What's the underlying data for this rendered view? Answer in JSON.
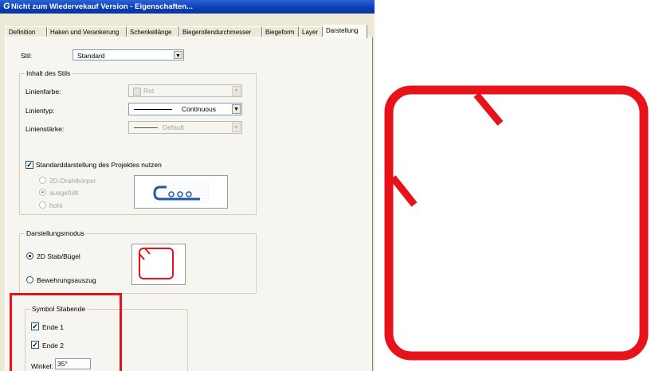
{
  "window": {
    "title": "Nicht zum Wiedervekauf Version - Eigenschaften...",
    "app_icon": "G"
  },
  "tabs": [
    "Definition",
    "Haken und Verankerung",
    "Schenkellänge",
    "Biegerollendurchmesser",
    "Biegeform",
    "Layer",
    "Darstellung"
  ],
  "active_tab": "Darstellung",
  "stil": {
    "label": "Stil:",
    "value": "Standard"
  },
  "inhalt": {
    "group_label": "Inhalt des Stils",
    "linienfarbe": {
      "label": "Linienfarbe:",
      "value": "Rot"
    },
    "linientyp": {
      "label": "Linientyp:",
      "value": "Continuous"
    },
    "linienstaerke": {
      "label": "Linienstärke:",
      "value": "Default"
    },
    "standard_checkbox": {
      "label": "Standarddarstellung des Projektes nutzen",
      "checked": true
    },
    "radios": [
      {
        "label": "2D-Drahtkörper",
        "selected": false
      },
      {
        "label": "ausgefüllt",
        "selected": true
      },
      {
        "label": "hohl",
        "selected": false
      }
    ]
  },
  "darstellungsmodus": {
    "group_label": "Darstellungsmodus",
    "options": [
      {
        "label": "2D Stab/Bügel",
        "selected": true
      },
      {
        "label": "Bewehrungsauszug",
        "selected": false
      }
    ]
  },
  "symbol_stabende": {
    "group_label": "Symbol Stabende",
    "ende1": {
      "label": "Ende 1",
      "checked": true
    },
    "ende2": {
      "label": "Ende 2",
      "checked": true
    },
    "winkel": {
      "label": "Winkel:",
      "value": "35°"
    }
  },
  "colors": {
    "highlight_red": "#e8121b",
    "rebar_red": "#e8121b",
    "title_blue": "#0a3db5"
  }
}
